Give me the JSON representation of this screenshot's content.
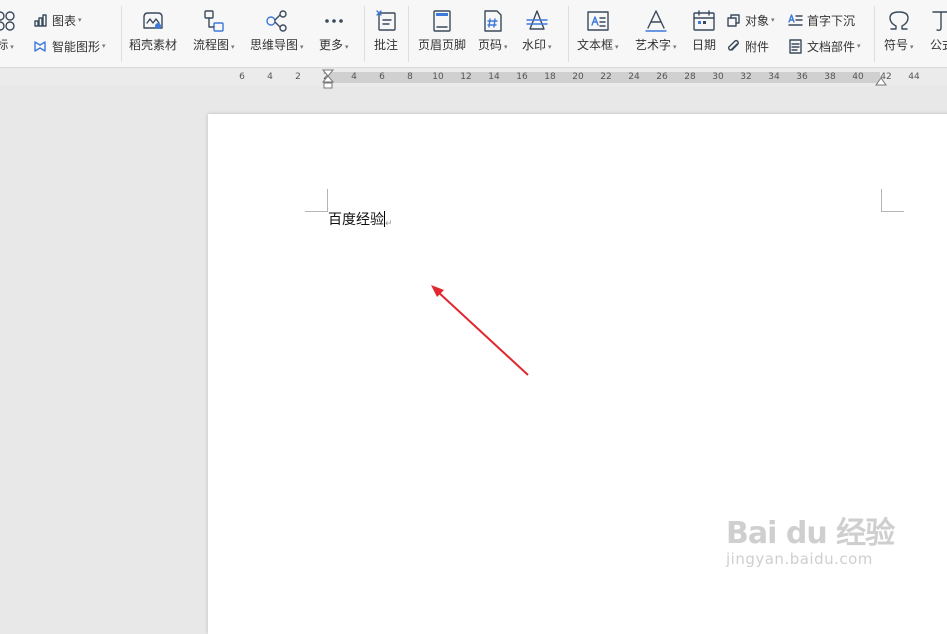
{
  "toolbar": {
    "icon_partial_label": "标",
    "chart_label": "图表",
    "smart_shape_label": "智能图形",
    "daoke_label": "稻壳素材",
    "flowchart_label": "流程图",
    "mindmap_label": "思维导图",
    "more_label": "更多",
    "comment_label": "批注",
    "header_footer_label": "页眉页脚",
    "page_number_label": "页码",
    "watermark_label": "水印",
    "textbox_label": "文本框",
    "wordart_label": "艺术字",
    "date_label": "日期",
    "object_label": "对象",
    "attachment_label": "附件",
    "dropcap_label": "首字下沉",
    "doc_parts_label": "文档部件",
    "symbol_label": "符号",
    "formula_partial_label": "公式",
    "caret_glyph": "▾"
  },
  "ruler": {
    "ticks": [
      "6",
      "4",
      "2",
      "2",
      "4",
      "6",
      "8",
      "10",
      "12",
      "14",
      "16",
      "18",
      "20",
      "22",
      "24",
      "26",
      "28",
      "30",
      "32",
      "34",
      "36",
      "38",
      "40",
      "42",
      "44"
    ]
  },
  "document": {
    "text": "百度经验",
    "paragraph_mark": "↵"
  },
  "watermark": {
    "logo_text": "Bai du 经验",
    "url": "jingyan.baidu.com"
  },
  "colors": {
    "toolbar_bg": "#f7f7f7",
    "canvas_bg": "#e8e8e8",
    "page_bg": "#ffffff",
    "arrow": "#e0282e",
    "accent_blue": "#3d79d8"
  }
}
